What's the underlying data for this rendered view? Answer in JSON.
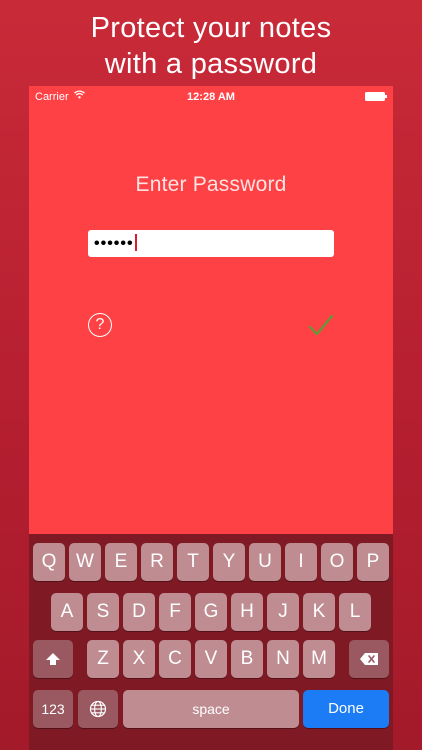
{
  "promo": {
    "line1": "Protect your notes",
    "line2": "with a password"
  },
  "status_bar": {
    "carrier": "Carrier",
    "time": "12:28 AM",
    "wifi_icon": "wifi-icon",
    "battery_icon": "battery-icon"
  },
  "screen": {
    "title": "Enter Password",
    "password_value": "••••••",
    "help_label": "?",
    "confirm_icon": "checkmark-icon"
  },
  "keyboard": {
    "row1": [
      "Q",
      "W",
      "E",
      "R",
      "T",
      "Y",
      "U",
      "I",
      "O",
      "P"
    ],
    "row2": [
      "A",
      "S",
      "D",
      "F",
      "G",
      "H",
      "J",
      "K",
      "L"
    ],
    "row3": [
      "Z",
      "X",
      "C",
      "V",
      "B",
      "N",
      "M"
    ],
    "numbers_label": "123",
    "space_label": "space",
    "done_label": "Done",
    "shift_icon": "shift-icon",
    "backspace_icon": "backspace-icon",
    "globe_icon": "globe-icon"
  },
  "colors": {
    "background": "#c92a38",
    "screen": "#fd4144",
    "keyboard": "#7f1a25",
    "key": "#be8c91",
    "done": "#1b7cf5",
    "checkmark": "#5e9b3a"
  }
}
